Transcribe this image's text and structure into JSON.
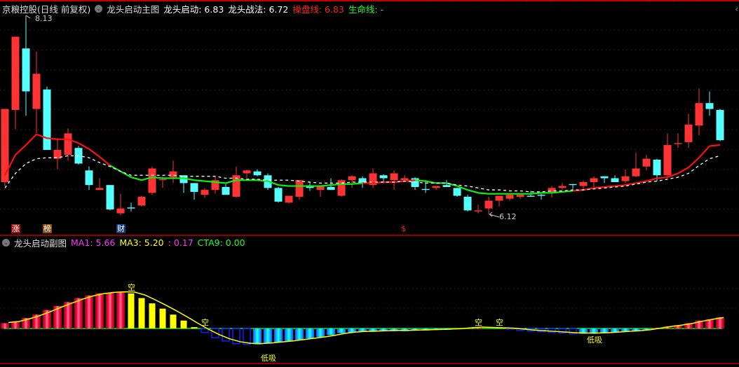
{
  "header": {
    "stock": "京粮控股(日线 前复权)",
    "indicator": "龙头启动主图",
    "values": [
      {
        "label": "龙头启动: 6.83",
        "color": "#ffffff"
      },
      {
        "label": "龙头战法: 6.72",
        "color": "#ffffff"
      },
      {
        "label": "操盘线: 6.83",
        "color": "#ff2020"
      },
      {
        "label": "生命线: -",
        "color": "#20ff20"
      }
    ]
  },
  "sub_header": {
    "indicator": "龙头启动副图",
    "values": [
      {
        "label": "MA1: 5.66",
        "color": "#ff33ff"
      },
      {
        "label": "MA3: 5.20",
        "color": "#ffff00"
      },
      {
        "label": ": 0.17",
        "color": "#ff33ff"
      },
      {
        "label": "CTA9: 0.00",
        "color": "#20ff20"
      }
    ]
  },
  "annotations": {
    "high_label": "8.13",
    "low_label": "6.12"
  },
  "tags": [
    {
      "text": "涨",
      "bg": "#a01010",
      "index": 1
    },
    {
      "text": "榜",
      "bg": "#8a4a10",
      "index": 4
    },
    {
      "text": "财",
      "bg": "#103a7a",
      "index": 11
    },
    {
      "text": "$",
      "bg": "transparent",
      "index": 38,
      "color": "#ff2020"
    }
  ],
  "signals": [
    {
      "text": "空",
      "index": 12,
      "pos": "top"
    },
    {
      "text": "空",
      "index": 19,
      "pos": "zero"
    },
    {
      "text": "空",
      "index": 45,
      "pos": "zero"
    },
    {
      "text": "空",
      "index": 47,
      "pos": "zero"
    },
    {
      "text": "低吸",
      "index": 25,
      "pos": "bottom"
    },
    {
      "text": "低吸",
      "index": 56,
      "pos": "bottom2"
    }
  ],
  "colors": {
    "up": "#ff3333",
    "down": "#54ffff",
    "ma_up": "#ff1010",
    "ma_down": "#10ee10",
    "grid": "#7a1010"
  },
  "chart_data": [
    {
      "type": "candlestick",
      "title": "龙头启动主图",
      "ylim": [
        6.05,
        8.2
      ],
      "ohlc": [
        [
          6.45,
          7.2,
          6.41,
          7.2
        ],
        [
          7.19,
          7.94,
          6.99,
          7.94
        ],
        [
          7.82,
          8.13,
          7.13,
          7.38
        ],
        [
          7.2,
          7.79,
          6.95,
          7.56
        ],
        [
          7.4,
          7.43,
          6.78,
          6.78
        ],
        [
          6.69,
          6.9,
          6.58,
          6.78
        ],
        [
          6.73,
          7.0,
          6.67,
          6.95
        ],
        [
          6.8,
          6.82,
          6.63,
          6.64
        ],
        [
          6.57,
          6.61,
          6.37,
          6.42
        ],
        [
          6.37,
          6.49,
          6.37,
          6.39
        ],
        [
          6.42,
          6.42,
          6.16,
          6.17
        ],
        [
          6.13,
          6.33,
          6.11,
          6.18
        ],
        [
          6.19,
          6.24,
          6.15,
          6.18
        ],
        [
          6.21,
          6.31,
          6.2,
          6.3
        ],
        [
          6.34,
          6.61,
          6.32,
          6.59
        ],
        [
          6.47,
          6.51,
          6.39,
          6.48
        ],
        [
          6.5,
          6.67,
          6.44,
          6.56
        ],
        [
          6.52,
          6.52,
          6.34,
          6.44
        ],
        [
          6.44,
          6.44,
          6.27,
          6.35
        ],
        [
          6.32,
          6.39,
          6.29,
          6.37
        ],
        [
          6.37,
          6.51,
          6.33,
          6.47
        ],
        [
          6.4,
          6.43,
          6.32,
          6.32
        ],
        [
          6.3,
          6.61,
          6.29,
          6.52
        ],
        [
          6.54,
          6.58,
          6.49,
          6.57
        ],
        [
          6.56,
          6.58,
          6.51,
          6.52
        ],
        [
          6.52,
          6.54,
          6.37,
          6.39
        ],
        [
          6.39,
          6.4,
          6.24,
          6.25
        ],
        [
          6.24,
          6.31,
          6.23,
          6.31
        ],
        [
          6.3,
          6.47,
          6.27,
          6.47
        ],
        [
          6.41,
          6.45,
          6.36,
          6.39
        ],
        [
          6.37,
          6.41,
          6.3,
          6.41
        ],
        [
          6.4,
          6.49,
          6.37,
          6.37
        ],
        [
          6.31,
          6.48,
          6.3,
          6.47
        ],
        [
          6.47,
          6.52,
          6.39,
          6.51
        ],
        [
          6.49,
          6.51,
          6.39,
          6.44
        ],
        [
          6.42,
          6.59,
          6.39,
          6.54
        ],
        [
          6.52,
          6.53,
          6.44,
          6.49
        ],
        [
          6.47,
          6.57,
          6.37,
          6.54
        ],
        [
          6.47,
          6.52,
          6.47,
          6.49
        ],
        [
          6.49,
          6.5,
          6.37,
          6.4
        ],
        [
          6.38,
          6.47,
          6.34,
          6.37
        ],
        [
          6.39,
          6.41,
          6.37,
          6.41
        ],
        [
          6.42,
          6.47,
          6.4,
          6.4
        ],
        [
          6.39,
          6.39,
          6.3,
          6.31
        ],
        [
          6.3,
          6.32,
          6.15,
          6.16
        ],
        [
          6.15,
          6.22,
          6.13,
          6.16
        ],
        [
          6.18,
          6.3,
          6.12,
          6.26
        ],
        [
          6.26,
          6.31,
          6.2,
          6.31
        ],
        [
          6.28,
          6.32,
          6.26,
          6.32
        ],
        [
          6.3,
          6.32,
          6.28,
          6.32
        ],
        [
          6.31,
          6.36,
          6.3,
          6.3
        ],
        [
          6.32,
          6.33,
          6.27,
          6.31
        ],
        [
          6.35,
          6.41,
          6.29,
          6.39
        ],
        [
          6.39,
          6.44,
          6.37,
          6.41
        ],
        [
          6.43,
          6.43,
          6.38,
          6.42
        ],
        [
          6.41,
          6.47,
          6.37,
          6.45
        ],
        [
          6.45,
          6.51,
          6.4,
          6.49
        ],
        [
          6.51,
          6.51,
          6.44,
          6.49
        ],
        [
          6.49,
          6.52,
          6.45,
          6.45
        ],
        [
          6.46,
          6.58,
          6.44,
          6.51
        ],
        [
          6.51,
          6.75,
          6.5,
          6.59
        ],
        [
          6.61,
          6.73,
          6.57,
          6.69
        ],
        [
          6.68,
          6.69,
          6.46,
          6.52
        ],
        [
          6.52,
          6.95,
          6.5,
          6.83
        ],
        [
          6.84,
          6.95,
          6.8,
          6.85
        ],
        [
          6.86,
          7.15,
          6.8,
          7.04
        ],
        [
          7.03,
          7.41,
          6.93,
          7.26
        ],
        [
          7.26,
          7.38,
          7.13,
          7.2
        ],
        [
          7.19,
          7.2,
          6.87,
          6.88
        ]
      ],
      "series": [
        {
          "name": "操盘线",
          "values": [
            6.52,
            6.73,
            6.83,
            6.94,
            6.9,
            6.89,
            6.89,
            6.85,
            6.79,
            6.71,
            6.62,
            6.56,
            6.5,
            6.47,
            6.5,
            6.49,
            6.49,
            6.49,
            6.47,
            6.46,
            6.45,
            6.44,
            6.47,
            6.47,
            6.47,
            6.46,
            6.42,
            6.41,
            6.41,
            6.41,
            6.41,
            6.42,
            6.43,
            6.43,
            6.44,
            6.44,
            6.45,
            6.45,
            6.46,
            6.47,
            6.46,
            6.44,
            6.44,
            6.41,
            6.37,
            6.34,
            6.33,
            6.33,
            6.33,
            6.33,
            6.33,
            6.34,
            6.34,
            6.35,
            6.36,
            6.37,
            6.39,
            6.4,
            6.41,
            6.42,
            6.44,
            6.46,
            6.49,
            6.5,
            6.54,
            6.6,
            6.7,
            6.82,
            6.83
          ],
          "green_ranges": [
            [
              11,
              34
            ],
            [
              40,
              54
            ]
          ]
        },
        {
          "name": "龙头战法",
          "values": [
            6.39,
            6.54,
            6.64,
            6.69,
            6.7,
            6.7,
            6.72,
            6.72,
            6.7,
            6.65,
            6.61,
            6.56,
            6.52,
            6.52,
            6.52,
            6.52,
            6.52,
            6.51,
            6.51,
            6.51,
            6.51,
            6.49,
            6.49,
            6.48,
            6.48,
            6.47,
            6.47,
            6.47,
            6.46,
            6.45,
            6.44,
            6.44,
            6.44,
            6.45,
            6.45,
            6.45,
            6.45,
            6.45,
            6.46,
            6.45,
            6.44,
            6.44,
            6.44,
            6.42,
            6.41,
            6.39,
            6.37,
            6.37,
            6.36,
            6.36,
            6.35,
            6.35,
            6.36,
            6.36,
            6.37,
            6.37,
            6.38,
            6.39,
            6.4,
            6.41,
            6.43,
            6.45,
            6.46,
            6.48,
            6.5,
            6.54,
            6.62,
            6.69,
            6.72
          ]
        }
      ]
    },
    {
      "type": "bar",
      "title": "龙头启动副图",
      "values": [
        0.08,
        0.11,
        0.16,
        0.21,
        0.28,
        0.34,
        0.4,
        0.46,
        0.5,
        0.53,
        0.54,
        0.55,
        0.53,
        0.46,
        0.38,
        0.3,
        0.21,
        0.12,
        0.02,
        -0.06,
        -0.14,
        -0.19,
        -0.23,
        -0.24,
        -0.24,
        -0.22,
        -0.21,
        -0.19,
        -0.17,
        -0.15,
        -0.13,
        -0.1,
        -0.07,
        -0.06,
        -0.05,
        -0.05,
        -0.04,
        -0.04,
        -0.04,
        -0.03,
        -0.03,
        -0.02,
        -0.02,
        -0.01,
        0.01,
        0.01,
        0,
        0,
        -0.01,
        -0.03,
        -0.04,
        -0.05,
        -0.06,
        -0.07,
        -0.08,
        -0.08,
        -0.08,
        -0.07,
        -0.06,
        -0.05,
        -0.04,
        -0.02,
        0.01,
        0.03,
        0.05,
        0.08,
        0.12,
        0.14,
        0.17
      ]
    }
  ]
}
